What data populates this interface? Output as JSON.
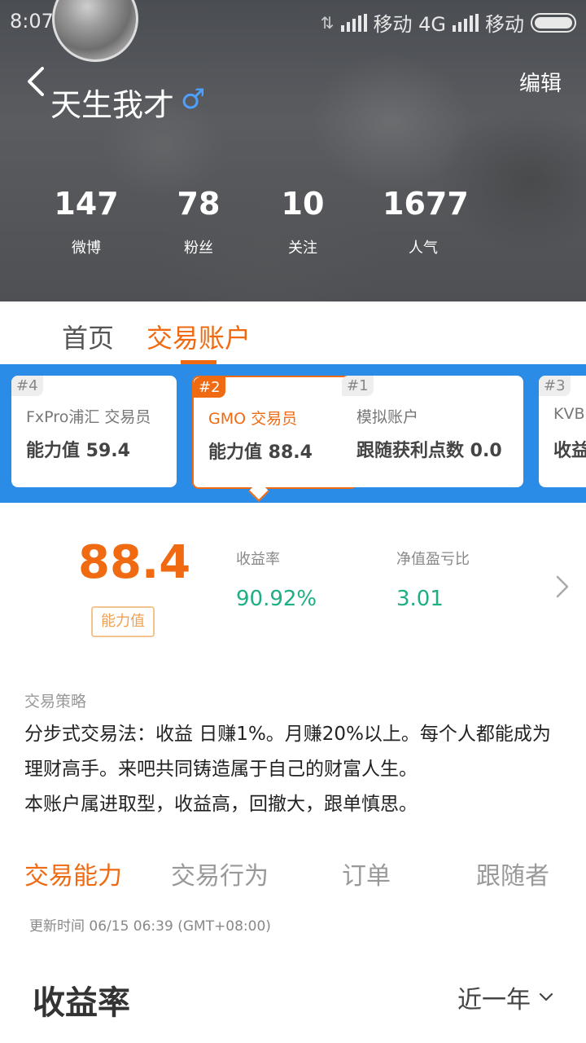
{
  "status_bar": {
    "time": "8:07",
    "carrier1": "移动 4G",
    "carrier2": "移动"
  },
  "profile": {
    "name": "天生我才",
    "gender_symbol": "♂",
    "edit_label": "编辑",
    "stats": [
      {
        "value": "147",
        "label": "微博"
      },
      {
        "value": "78",
        "label": "粉丝"
      },
      {
        "value": "10",
        "label": "关注"
      },
      {
        "value": "1677",
        "label": "人气"
      }
    ]
  },
  "tabs": [
    {
      "label": "首页",
      "active": false
    },
    {
      "label": "交易账户",
      "active": true
    }
  ],
  "accounts": [
    {
      "rank": "#4",
      "name": "FxPro浦汇 交易员",
      "value": "能力值 59.4",
      "selected": false
    },
    {
      "rank": "#2",
      "name": "GMO 交易员",
      "value": "能力值 88.4",
      "selected": true
    },
    {
      "rank": "#1",
      "name": "模拟账户",
      "value": "跟随获利点数 0.0",
      "selected": false
    },
    {
      "rank": "#3",
      "name": "KVB",
      "value": "收益",
      "selected": false
    }
  ],
  "metrics": {
    "ability_value": "88.4",
    "ability_label": "能力值",
    "return_label": "收益率",
    "return_value": "90.92%",
    "pl_ratio_label": "净值盈亏比",
    "pl_ratio_value": "3.01"
  },
  "strategy": {
    "title": "交易策略",
    "lines": [
      "分步式交易法：收益 日赚1%。月赚20%以上。每个人都能成为",
      "理财高手。来吧共同铸造属于自己的财富人生。",
      "本账户属进取型，收益高，回撤大，跟单慎思。"
    ]
  },
  "sub_tabs": [
    {
      "label": "交易能力",
      "active": true
    },
    {
      "label": "交易行为",
      "active": false
    },
    {
      "label": "订单",
      "active": false
    },
    {
      "label": "跟随者",
      "active": false
    }
  ],
  "update_time": "更新时间 06/15 06:39 (GMT+08:00)",
  "section": {
    "title": "收益率",
    "period": "近一年"
  },
  "colors": {
    "accent": "#f06a12",
    "strip_blue": "#2a8ce6",
    "positive_green": "#1fae84"
  }
}
